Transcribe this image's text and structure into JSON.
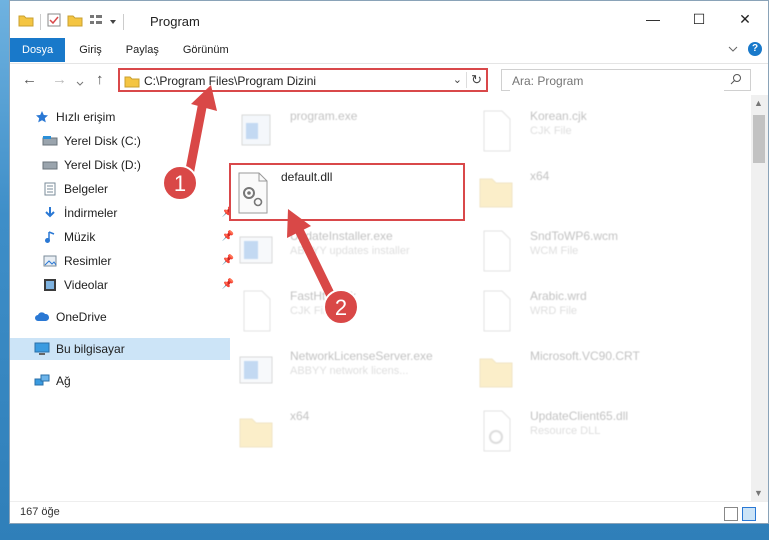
{
  "window": {
    "title": "Program"
  },
  "qat": {
    "dropdown_icon": "chevron-down-icon"
  },
  "ribbon": {
    "tabs": [
      "Dosya",
      "Giriş",
      "Paylaş",
      "Görünüm"
    ],
    "accent": "#1979ca",
    "help_label": "?"
  },
  "window_controls": {
    "minimize": "—",
    "maximize": "☐",
    "close": "✕"
  },
  "nav": {
    "back": "←",
    "forward": "→",
    "up": "↑"
  },
  "address": {
    "path": "C:\\Program Files\\Program Dizini",
    "dropdown": "⌄",
    "refresh": "↻"
  },
  "search": {
    "placeholder": "Ara: Program"
  },
  "sidebar": {
    "items": [
      {
        "label": "Hızlı erişim",
        "icon": "star-icon",
        "pinned": false
      },
      {
        "label": "Yerel Disk (C:)",
        "icon": "drive-icon",
        "pinned": false
      },
      {
        "label": "Yerel Disk (D:)",
        "icon": "drive-icon",
        "pinned": false
      },
      {
        "label": "Belgeler",
        "icon": "documents-icon",
        "pinned": false
      },
      {
        "label": "İndirmeler",
        "icon": "download-icon",
        "pinned": true
      },
      {
        "label": "Müzik",
        "icon": "music-icon",
        "pinned": true
      },
      {
        "label": "Resimler",
        "icon": "pictures-icon",
        "pinned": true
      },
      {
        "label": "Videolar",
        "icon": "videos-icon",
        "pinned": true
      },
      {
        "label": "OneDrive",
        "icon": "cloud-icon",
        "pinned": false
      },
      {
        "label": "Bu bilgisayar",
        "icon": "computer-icon",
        "pinned": false,
        "selected": true
      },
      {
        "label": "Ağ",
        "icon": "network-icon",
        "pinned": false
      }
    ],
    "pin_glyph": "📌"
  },
  "files": [
    {
      "name": "program.exe",
      "desc": "",
      "icon": "exe-icon",
      "faded": true
    },
    {
      "name": "Korean.cjk",
      "desc": "CJK File",
      "icon": "file-icon",
      "faded": true
    },
    {
      "name": "default.dll",
      "desc": "",
      "icon": "dll-gear-icon",
      "faded": false,
      "highlighted": true
    },
    {
      "name": "x64",
      "desc": "",
      "icon": "folder-icon",
      "faded": true
    },
    {
      "name": "UpdateInstaller.exe",
      "desc": "ABBYY updates installer",
      "icon": "exe-icon",
      "faded": true
    },
    {
      "name": "SndToWP6.wcm",
      "desc": "WCM File",
      "icon": "file-icon",
      "faded": true
    },
    {
      "name": "FastHtml.cjk",
      "desc": "CJK File",
      "icon": "file-icon",
      "faded": true
    },
    {
      "name": "Arabic.wrd",
      "desc": "WRD File",
      "icon": "file-icon",
      "faded": true
    },
    {
      "name": "NetworkLicenseServer.exe",
      "desc": "ABBYY network licens...",
      "icon": "exe-icon",
      "faded": true
    },
    {
      "name": "Microsoft.VC90.CRT",
      "desc": "",
      "icon": "folder-icon",
      "faded": true
    },
    {
      "name": "x64",
      "desc": "",
      "icon": "folder-icon",
      "faded": true
    },
    {
      "name": "UpdateClient65.dll",
      "desc": "Resource DLL",
      "icon": "dll-gear-icon",
      "faded": true
    }
  ],
  "status": {
    "count": "167 öğe"
  },
  "annotations": [
    {
      "label": "1",
      "color": "#e0484a"
    },
    {
      "label": "2",
      "color": "#e0484a"
    }
  ]
}
